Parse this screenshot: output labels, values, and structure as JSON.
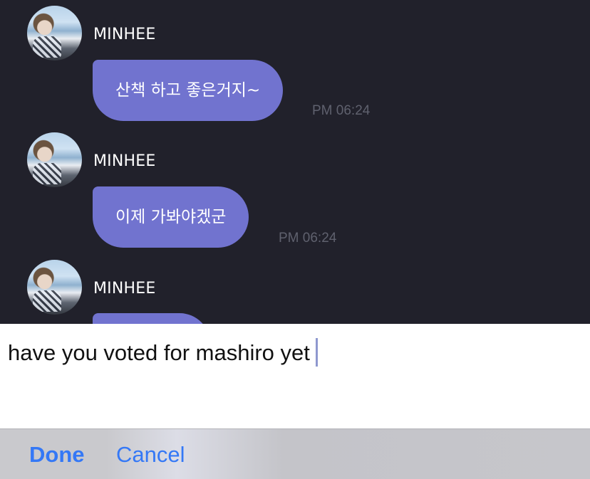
{
  "chat": {
    "messages": [
      {
        "sender": "MINHEE",
        "text": "산책 하고 좋은거지~",
        "time": "PM 06:24"
      },
      {
        "sender": "MINHEE",
        "text": "이제 가봐야겠군",
        "time": "PM 06:24"
      },
      {
        "sender": "MINHEE",
        "text": "",
        "time": ""
      }
    ]
  },
  "input": {
    "value": "have you voted for mashiro yet"
  },
  "toolbar": {
    "done_label": "Done",
    "cancel_label": "Cancel"
  },
  "colors": {
    "chat_background": "#21212b",
    "bubble": "#7173cf",
    "accent": "#3478f6"
  }
}
